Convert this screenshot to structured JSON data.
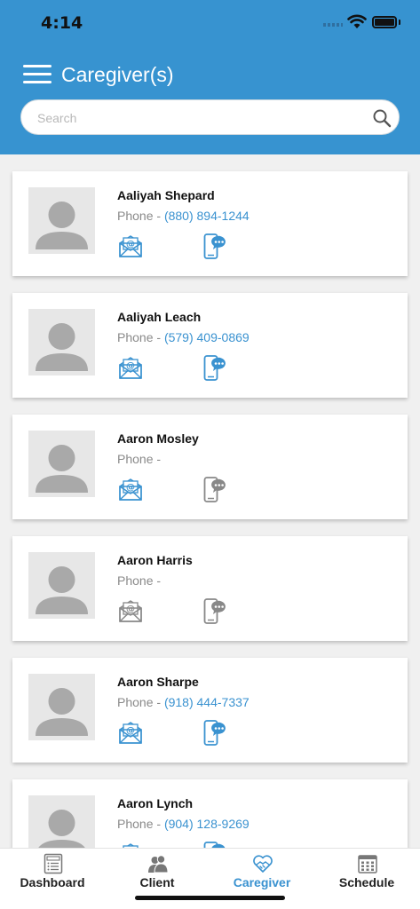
{
  "status": {
    "time": "4:14"
  },
  "header": {
    "title": "Caregiver(s)"
  },
  "search": {
    "placeholder": "Search"
  },
  "caregivers": [
    {
      "name": "Aaliyah Shepard",
      "phone_label": "Phone -",
      "phone": "(880) 894-1244",
      "email_active": true,
      "sms_active": true
    },
    {
      "name": "Aaliyah Leach",
      "phone_label": "Phone -",
      "phone": "(579) 409-0869",
      "email_active": true,
      "sms_active": true
    },
    {
      "name": "Aaron Mosley",
      "phone_label": "Phone -",
      "phone": "",
      "email_active": true,
      "sms_active": false
    },
    {
      "name": "Aaron Harris",
      "phone_label": "Phone -",
      "phone": "",
      "email_active": false,
      "sms_active": false
    },
    {
      "name": "Aaron Sharpe",
      "phone_label": "Phone -",
      "phone": "(918) 444-7337",
      "email_active": true,
      "sms_active": true
    },
    {
      "name": "Aaron Lynch",
      "phone_label": "Phone -",
      "phone": "(904) 128-9269",
      "email_active": true,
      "sms_active": true
    }
  ],
  "tabs": [
    {
      "label": "Dashboard",
      "icon": "dashboard-icon",
      "active": false
    },
    {
      "label": "Client",
      "icon": "client-icon",
      "active": false
    },
    {
      "label": "Caregiver",
      "icon": "caregiver-icon",
      "active": true
    },
    {
      "label": "Schedule",
      "icon": "schedule-icon",
      "active": false
    }
  ],
  "colors": {
    "header": "#3793d0",
    "accent": "#3a92d0",
    "inactive_icon": "#888888"
  }
}
